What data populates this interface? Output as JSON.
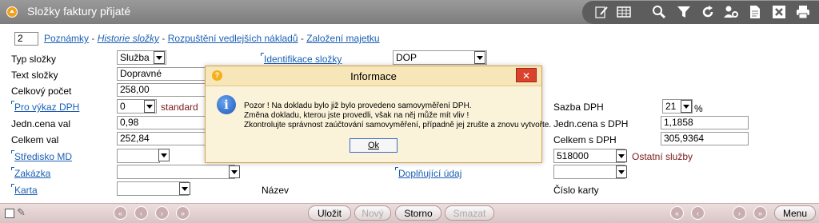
{
  "window": {
    "title": "Složky faktury přijaté"
  },
  "toolbar": {
    "icons": [
      "edit-icon",
      "table-icon",
      "search-icon",
      "filter-icon",
      "refresh-icon",
      "settings-icon",
      "document-icon",
      "excel-icon",
      "print-icon"
    ]
  },
  "top": {
    "number": "2",
    "links": [
      "Poznámky",
      "Historie složky",
      "Rozpuštění vedlejších nákladů",
      "Založení majetku"
    ]
  },
  "form": {
    "typ_slozky_label": "Typ složky",
    "typ_slozky_value": "Služba",
    "identifikace_label": "Identifikace složky",
    "identifikace_value": "DOP",
    "text_slozky_label": "Text složky",
    "text_slozky_value": "Dopravné",
    "celkovy_pocet_label": "Celkový počet",
    "celkovy_pocet_value": "258,00",
    "pro_vykaz_label": "Pro výkaz DPH",
    "pro_vykaz_value": "0",
    "pro_vykaz_note": "standard",
    "sazba_label": "Sazba DPH",
    "sazba_value": "21",
    "sazba_unit": "%",
    "jedn_cena_val_label": "Jedn.cena val",
    "jedn_cena_val_value": "0,98",
    "jedn_cena_dph_label": "Jedn.cena s DPH",
    "jedn_cena_dph_value": "1,1858",
    "celkem_val_label": "Celkem val",
    "celkem_val_value": "252,84",
    "celkem_dph_label": "Celkem s DPH",
    "celkem_dph_value": "305,9364",
    "stredisko_label": "Středisko MD",
    "ucet_value": "518000",
    "ucet_note": "Ostatní služby",
    "zakazka_label": "Zakázka",
    "doplnujici_label": "Doplňující údaj",
    "karta_label": "Karta",
    "nazev_label": "Název",
    "cislo_karty_label": "Číslo karty"
  },
  "dialog": {
    "title": "Informace",
    "close": "✕",
    "lines": [
      "Pozor ! Na dokladu bylo již bylo provedeno samovyměření DPH.",
      "Změna dokladu, kterou jste provedli, však na něj může mít vliv !",
      "Zkontrolujte správnost zaúčtování samovyměření, případně jej zrušte a znovu vytvořte."
    ],
    "ok": "Ok"
  },
  "bottom": {
    "ulozit": "Uložit",
    "novy": "Nový",
    "storno": "Storno",
    "smazat": "Smazat",
    "menu": "Menu"
  }
}
